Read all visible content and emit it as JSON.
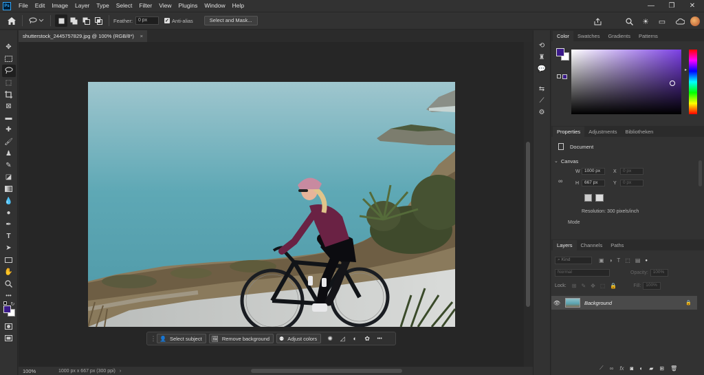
{
  "menubar": {
    "logo": "Ps",
    "items": [
      "File",
      "Edit",
      "Image",
      "Layer",
      "Type",
      "Select",
      "Filter",
      "View",
      "Plugins",
      "Window",
      "Help"
    ],
    "window_controls": [
      "minimize-icon",
      "restore-icon",
      "close-icon"
    ]
  },
  "options": {
    "feather_label": "Feather:",
    "feather_value": "0 px",
    "antialias_label": "Anti-alias",
    "antialias_checked": true,
    "select_mask_label": "Select and Mask..."
  },
  "document": {
    "tab_title": "shutterstock_2445757829.jpg @ 100% (RGB/8*)",
    "close_glyph": "×",
    "zoom": "100%",
    "doc_info": "1000 px x 667 px (300 ppi)"
  },
  "taskbar": {
    "select_subject": "Select subject",
    "remove_background": "Remove background",
    "adjust_colors": "Adjust colors",
    "more": "•••"
  },
  "color_panel": {
    "tabs": [
      "Color",
      "Swatches",
      "Gradients",
      "Patterns"
    ],
    "foreground": "#3b1a8a",
    "background": "#ffffff",
    "hue_base": "#7b3fe4"
  },
  "properties_panel": {
    "tabs": [
      "Properties",
      "Adjustments",
      "Bibliotheken"
    ],
    "doc_label": "Document",
    "canvas_label": "Canvas",
    "w_label": "W",
    "w_value": "1000 px",
    "h_label": "H",
    "h_value": "667 px",
    "x_label": "X",
    "x_value": "0 px",
    "y_label": "Y",
    "y_value": "0 px",
    "resolution": "Resolution: 300 pixels/inch",
    "mode_label": "Mode"
  },
  "layers_panel": {
    "tabs": [
      "Layers",
      "Channels",
      "Paths"
    ],
    "filter_kind": "Kind",
    "blend_mode": "Normal",
    "opacity_label": "Opacity:",
    "opacity_value": "100%",
    "lock_label": "Lock:",
    "fill_label": "Fill:",
    "fill_value": "100%",
    "layer_name": "Background"
  }
}
